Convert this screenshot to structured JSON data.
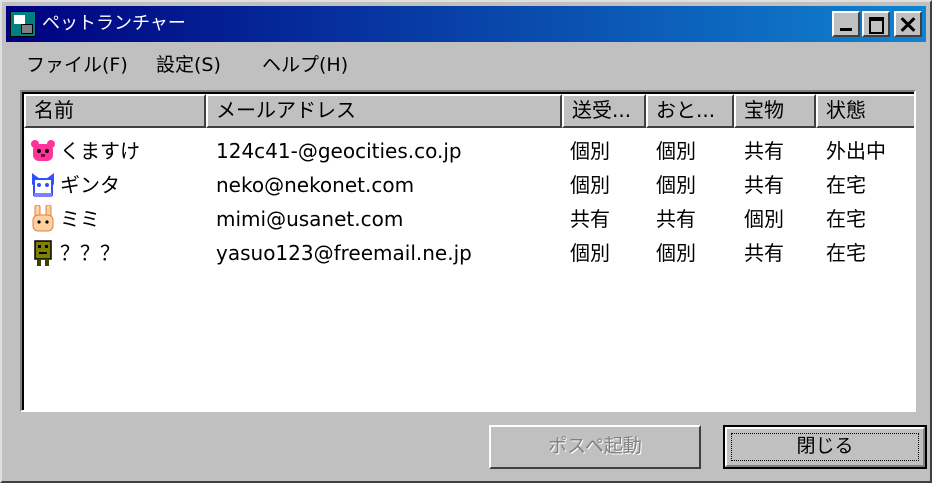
{
  "window": {
    "title": "ペットランチャー",
    "title_bar_color": "#000080"
  },
  "menu": {
    "items": [
      {
        "label": "ファイル(F)"
      },
      {
        "label": "設定(S)"
      },
      {
        "label": "ヘルプ(H)"
      }
    ]
  },
  "list": {
    "columns": [
      "名前",
      "メールアドレス",
      "送受...",
      "おと...",
      "宝物",
      "状態"
    ],
    "rows": [
      {
        "icon": "pink-bear-icon",
        "name": "くますけ",
        "email": "124c41-@geocities.co.jp",
        "send": "個別",
        "sound": "個別",
        "treasure": "共有",
        "status": "外出中"
      },
      {
        "icon": "cat-icon",
        "name": "ギンタ",
        "email": "neko@nekonet.com",
        "send": "個別",
        "sound": "個別",
        "treasure": "共有",
        "status": "在宅"
      },
      {
        "icon": "rabbit-icon",
        "name": "ミミ",
        "email": "mimi@usanet.com",
        "send": "共有",
        "sound": "共有",
        "treasure": "個別",
        "status": "在宅"
      },
      {
        "icon": "robot-icon",
        "name": "？？？",
        "email": "yasuo123@freemail.ne.jp",
        "send": "個別",
        "sound": "個別",
        "treasure": "共有",
        "status": "在宅"
      }
    ]
  },
  "buttons": {
    "launch_label": "ポスペ起動",
    "close_label": "閉じる"
  }
}
